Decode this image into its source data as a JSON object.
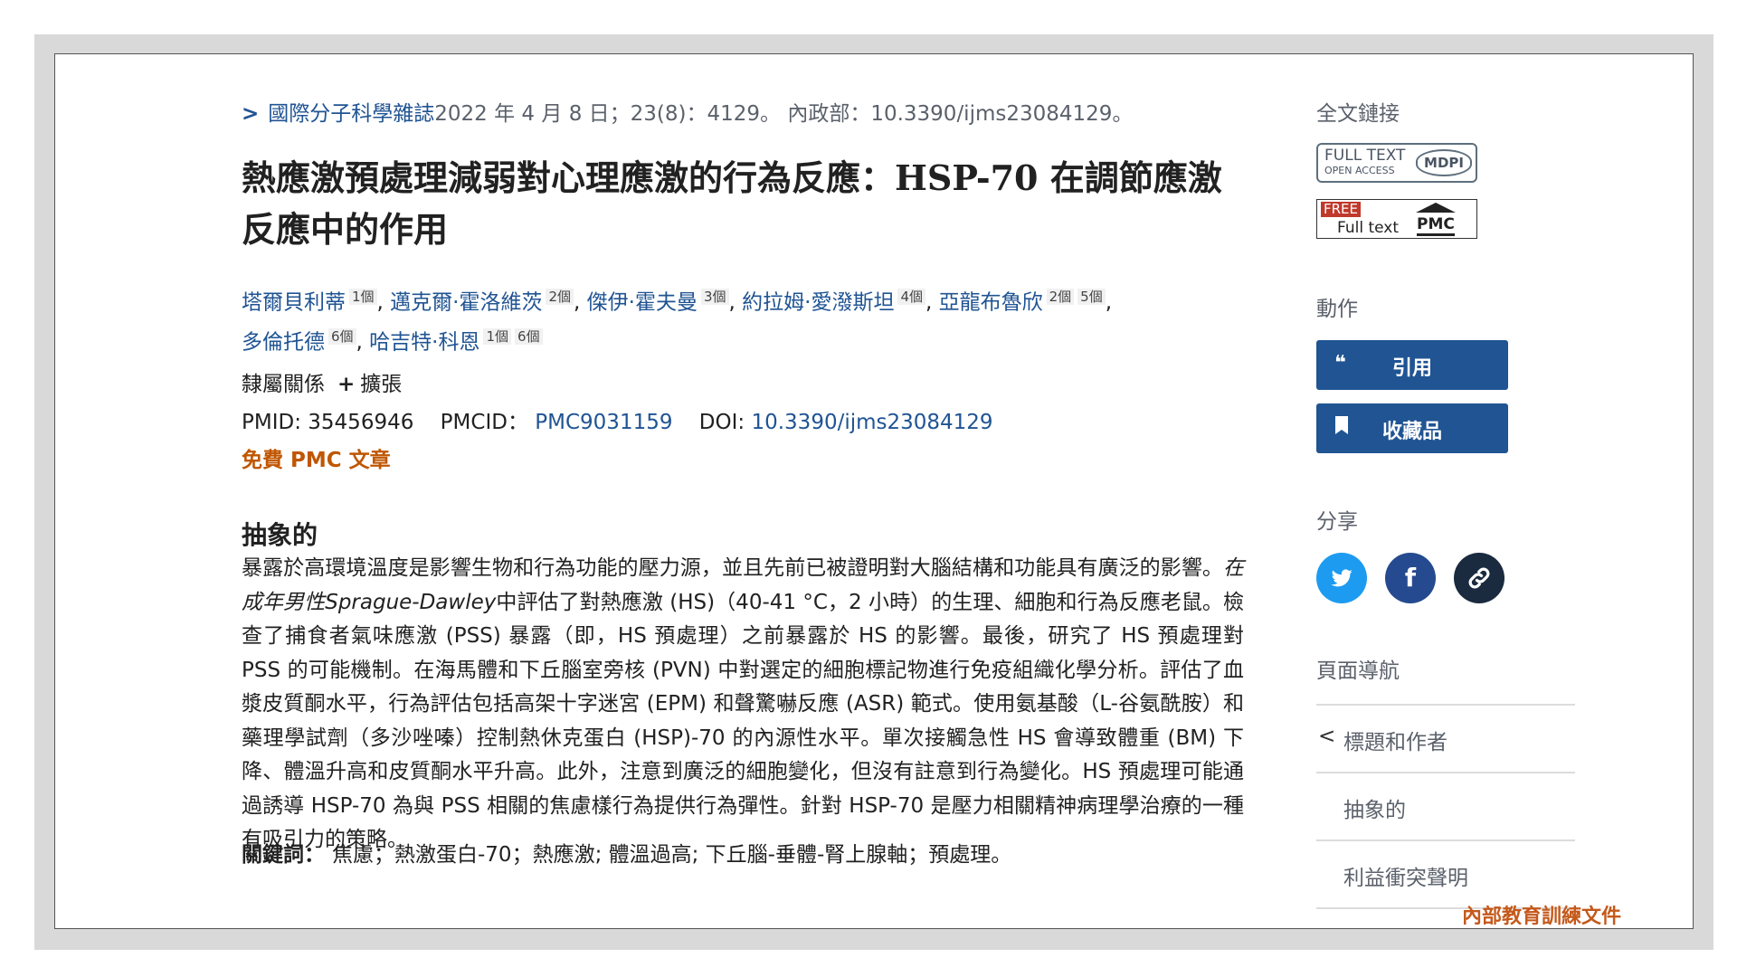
{
  "citation": {
    "journal": "國際分子科學雜誌",
    "details": "2022 年 4 月 8 日；23(8)：4129。 內政部：10.3390/ijms23084129。"
  },
  "article": {
    "title": "熱應激預處理減弱對心理應激的行為反應：HSP-70 在調節應激反應中的作用",
    "authors": [
      {
        "name": "塔爾貝利蒂",
        "sups": [
          "1個"
        ]
      },
      {
        "name": "邁克爾·霍洛維茨",
        "sups": [
          "2個"
        ]
      },
      {
        "name": "傑伊·霍夫曼",
        "sups": [
          "3個"
        ]
      },
      {
        "name": "約拉姆·愛潑斯坦",
        "sups": [
          "4個"
        ]
      },
      {
        "name": "亞龍布魯欣",
        "sups": [
          "2個",
          "5個"
        ]
      },
      {
        "name": "多倫托德",
        "sups": [
          "6個"
        ]
      },
      {
        "name": "哈吉特·科恩",
        "sups": [
          "1個",
          "6個"
        ]
      }
    ],
    "affiliations_label": "隸屬關係",
    "expand_label": "擴張",
    "pmid_label": "PMID:",
    "pmid": "35456946",
    "pmcid_label": "PMCID：",
    "pmcid": "PMC9031159",
    "doi_label": "DOI:",
    "doi": "10.3390/ijms23084129",
    "free_pmc": "免費 PMC 文章",
    "abstract_heading": "抽象的",
    "abstract_part1": "暴露於高環境溫度是影響生物和行為功能的壓力源，並且先前已被證明對大腦結構和功能具有廣泛的影響。",
    "abstract_italic": "在成年男性Sprague-Dawley",
    "abstract_part2": "中評估了對熱應激 (HS)（40-41 °C，2 小時）的生理、細胞和行為反應老鼠。檢查了捕食者氣味應激 (PSS) 暴露（即，HS 預處理）之前暴露於 HS 的影響。最後，研究了 HS 預處理對 PSS 的可能機制。在海馬體和下丘腦室旁核 (PVN) 中對選定的細胞標記物進行免疫組織化學分析。評估了血漿皮質酮水平，行為評估包括高架十字迷宮 (EPM) 和聲驚嚇反應 (ASR) 範式。使用氨基酸（L-谷氨酰胺）和藥理學試劑（多沙唑嗪）控制熱休克蛋白 (HSP)-70 的內源性水平。單次接觸急性 HS 會導致體重 (BM) 下降、體溫升高和皮質酮水平升高。此外，注意到廣泛的細胞變化，但沒有註意到行為變化。HS 預處理可能通過誘導 HSP-70 為與 PSS 相關的焦慮樣行為提供行為彈性。針對 HSP-70 是壓力相關精神病理學治療的一種有吸引力的策略。",
    "keywords_label": "關鍵詞：",
    "keywords": "焦慮；熱激蛋白-70；熱應激; 體溫過高; 下丘腦-垂體-腎上腺軸；預處理。"
  },
  "sidebar": {
    "full_text_heading": "全文鏈接",
    "mdpi_badge": {
      "line1": "FULL TEXT",
      "line2": "OPEN ACCESS",
      "logo": "MDPI"
    },
    "pmc_badge": {
      "free": "FREE",
      "text": "Full text",
      "logo": "PMC"
    },
    "actions_heading": "動作",
    "cite_label": "引用",
    "collections_label": "收藏品",
    "share_heading": "分享",
    "page_nav_heading": "頁面導航",
    "nav_items": [
      "標題和作者",
      "抽象的",
      "利益衝突聲明"
    ]
  },
  "watermark": "內部教育訓練文件",
  "colors": {
    "link": "#205493",
    "button": "#205493",
    "accent": "#c05600",
    "twitter": "#1d9bf0",
    "facebook": "#254a8f",
    "copylink": "#1a2a3f"
  }
}
